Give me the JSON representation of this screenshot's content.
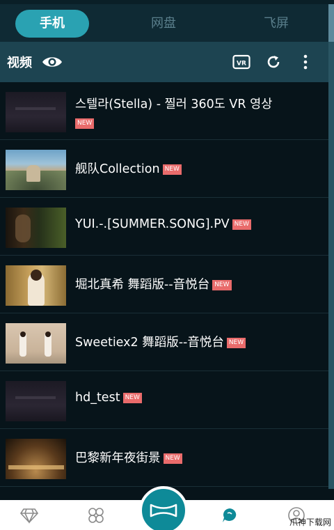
{
  "tabs": [
    {
      "label": "手机",
      "active": true
    },
    {
      "label": "网盘",
      "active": false
    },
    {
      "label": "飞屏",
      "active": false
    }
  ],
  "toolbar": {
    "title": "视频",
    "icons": [
      "eye-icon",
      "vr-icon",
      "refresh-icon",
      "more-icon"
    ],
    "vr_label": "VR"
  },
  "videos": [
    {
      "title": "스텔라(Stella) - 찔러 360도 VR 영상",
      "badge": "NEW"
    },
    {
      "title": "舰队Collection",
      "badge": "NEW"
    },
    {
      "title": "YUI.-.[SUMMER.SONG].PV",
      "badge": "NEW"
    },
    {
      "title": "堀北真希 舞蹈版--音悦台",
      "badge": "NEW"
    },
    {
      "title": "Sweetiex2 舞蹈版--音悦台",
      "badge": "NEW"
    },
    {
      "title": "hd_test",
      "badge": "NEW"
    },
    {
      "title": "巴黎新年夜街景",
      "badge": "NEW"
    }
  ],
  "bottom_nav": [
    "diamond-icon",
    "clover-icon",
    "bowtie-icon",
    "chat-icon",
    "profile-icon"
  ],
  "watermark": "爪神下载网",
  "colors": {
    "accent": "#2aa2b2",
    "background": "#07141a",
    "toolbar": "#1d4451",
    "badge": "#e96b6b"
  }
}
